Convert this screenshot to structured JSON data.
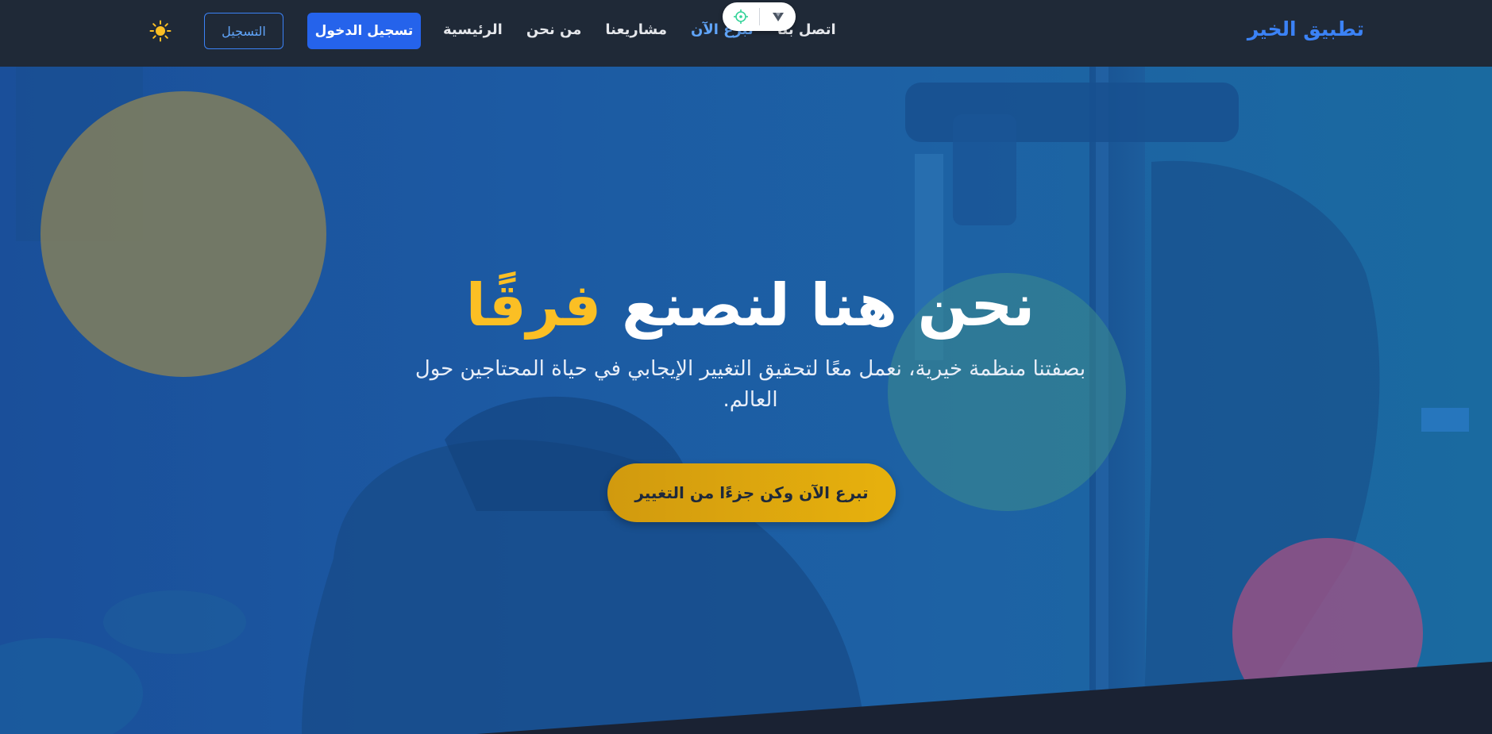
{
  "navbar": {
    "brand": "تطبيق الخير",
    "links": [
      {
        "label": "الرئيسية"
      },
      {
        "label": "من نحن"
      },
      {
        "label": "مشاريعنا"
      },
      {
        "label": "تبرع الآن"
      },
      {
        "label": "اتصل بنا"
      }
    ],
    "active_link": "تبرع الآن",
    "login_label": "تسجيل الدخول",
    "register_label": "التسجيل",
    "theme_icon": "sun-icon"
  },
  "floating_toolbar": {
    "icons": [
      "crosshair-icon",
      "logo-icon"
    ]
  },
  "hero": {
    "title_main": "نحن هنا لنصنع",
    "title_highlight": "فرقًا",
    "subtitle": "بصفتنا منظمة خيرية، نعمل معًا لتحقيق التغيير الإيجابي في حياة المحتاجين حول العالم.",
    "cta_label": "تبرع الآن وكن جزءًا من التغيير"
  },
  "colors": {
    "brand": "#3b82f6",
    "navbar_bg": "#1f2937",
    "accent_yellow": "#fbbf24",
    "primary_button": "#2563eb",
    "active_link": "#60a5fa",
    "hero_overlay": "#1c5aa3"
  }
}
